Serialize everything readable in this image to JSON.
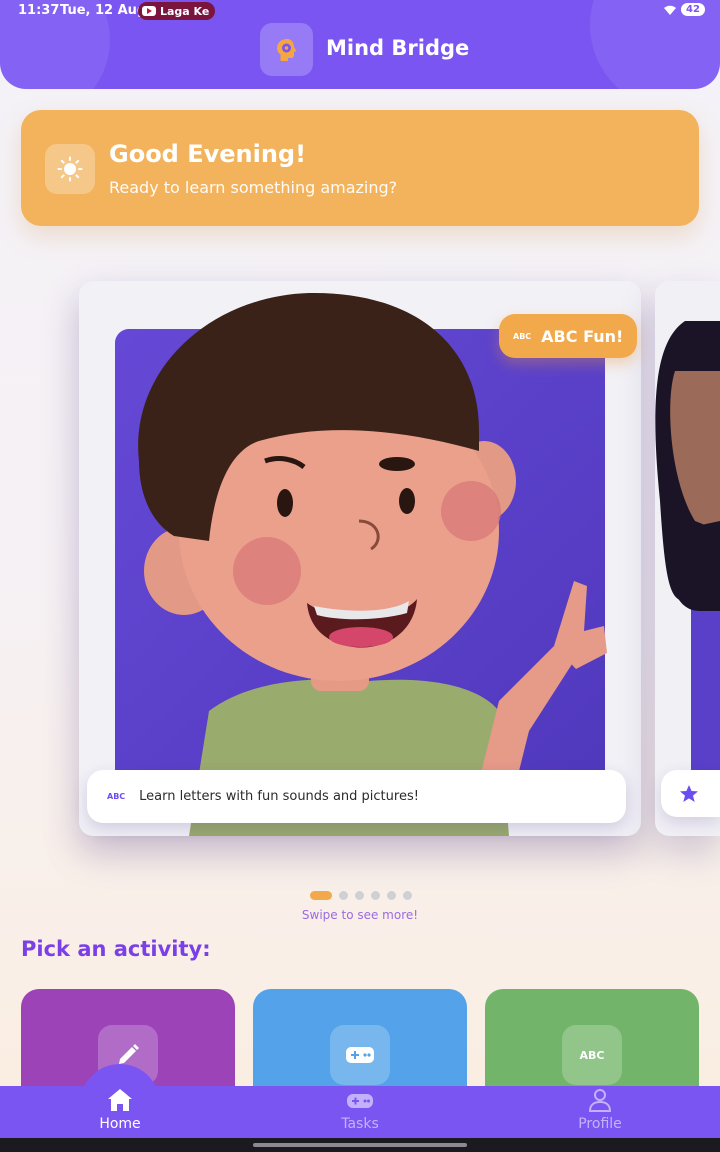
{
  "status_bar": {
    "time": "11:37",
    "date": "Tue, 12 Aug",
    "notification_chip": "Laga Ke",
    "battery": "42"
  },
  "header": {
    "app_title": "Mind Bridge",
    "logo_icon": "brain-gear-icon"
  },
  "greeting": {
    "title": "Good Evening!",
    "subtitle": "Ready to learn something amazing?",
    "icon": "sun-icon"
  },
  "carousel": {
    "current": {
      "badge_label": "ABC Fun!",
      "badge_icon_text": "ABC",
      "caption_icon_text": "ABC",
      "caption": "Learn letters with fun sounds and pictures!",
      "illustration": "cartoon-boy-pointing"
    },
    "next_caption_icon": "star-icon",
    "page_count": 6,
    "active_index": 0,
    "hint": "Swipe to see more!"
  },
  "activities": {
    "section_title": "Pick an activity:",
    "items": [
      {
        "icon": "pencil-icon",
        "color": "#9c43b8"
      },
      {
        "icon": "gamepad-icon",
        "color": "#53a2ea"
      },
      {
        "icon": "abc-icon",
        "icon_text": "ABC",
        "color": "#72b56a"
      }
    ]
  },
  "bottom_nav": {
    "items": [
      {
        "label": "Home",
        "icon": "home-icon",
        "active": true
      },
      {
        "label": "Tasks",
        "icon": "gamepad-icon",
        "active": false
      },
      {
        "label": "Profile",
        "icon": "person-icon",
        "active": false
      }
    ]
  },
  "colors": {
    "primary": "#7a55f2",
    "greeting_card": "#f2b35c",
    "accent_orange": "#f2a94b",
    "section_title": "#7a3fe6"
  }
}
